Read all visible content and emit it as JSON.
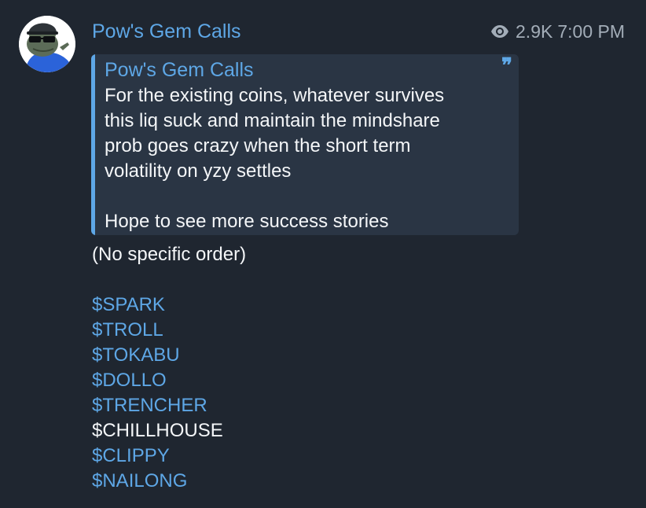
{
  "post": {
    "channel_name": "Pow's Gem Calls",
    "views": "2.9K",
    "time": "7:00 PM",
    "avatar_icon": "pepe-sunglasses-avatar",
    "view_icon": "eye-icon"
  },
  "quote": {
    "author": "Pow's Gem Calls",
    "lines": [
      "For the existing coins, whatever survives",
      "this liq suck and maintain the mindshare",
      "prob goes crazy when the short term",
      "volatility on yzy settles"
    ],
    "closing": "Hope to see more success stories",
    "quote_icon": "quote-mark-icon"
  },
  "message": {
    "intro": "(No specific order)",
    "tickers": [
      {
        "label": "$SPARK",
        "linked": true
      },
      {
        "label": "$TROLL",
        "linked": true
      },
      {
        "label": "$TOKABU",
        "linked": true
      },
      {
        "label": "$DOLLO",
        "linked": true
      },
      {
        "label": "$TRENCHER",
        "linked": true
      },
      {
        "label": "$CHILLHOUSE",
        "linked": false
      },
      {
        "label": "$CLIPPY",
        "linked": true
      },
      {
        "label": "$NAILONG",
        "linked": true
      }
    ]
  },
  "colors": {
    "background": "#1f2630",
    "accent": "#5ea7e6",
    "quote_background": "#2a3544",
    "text": "#f4f6f8",
    "meta_text": "#a3adb8"
  }
}
